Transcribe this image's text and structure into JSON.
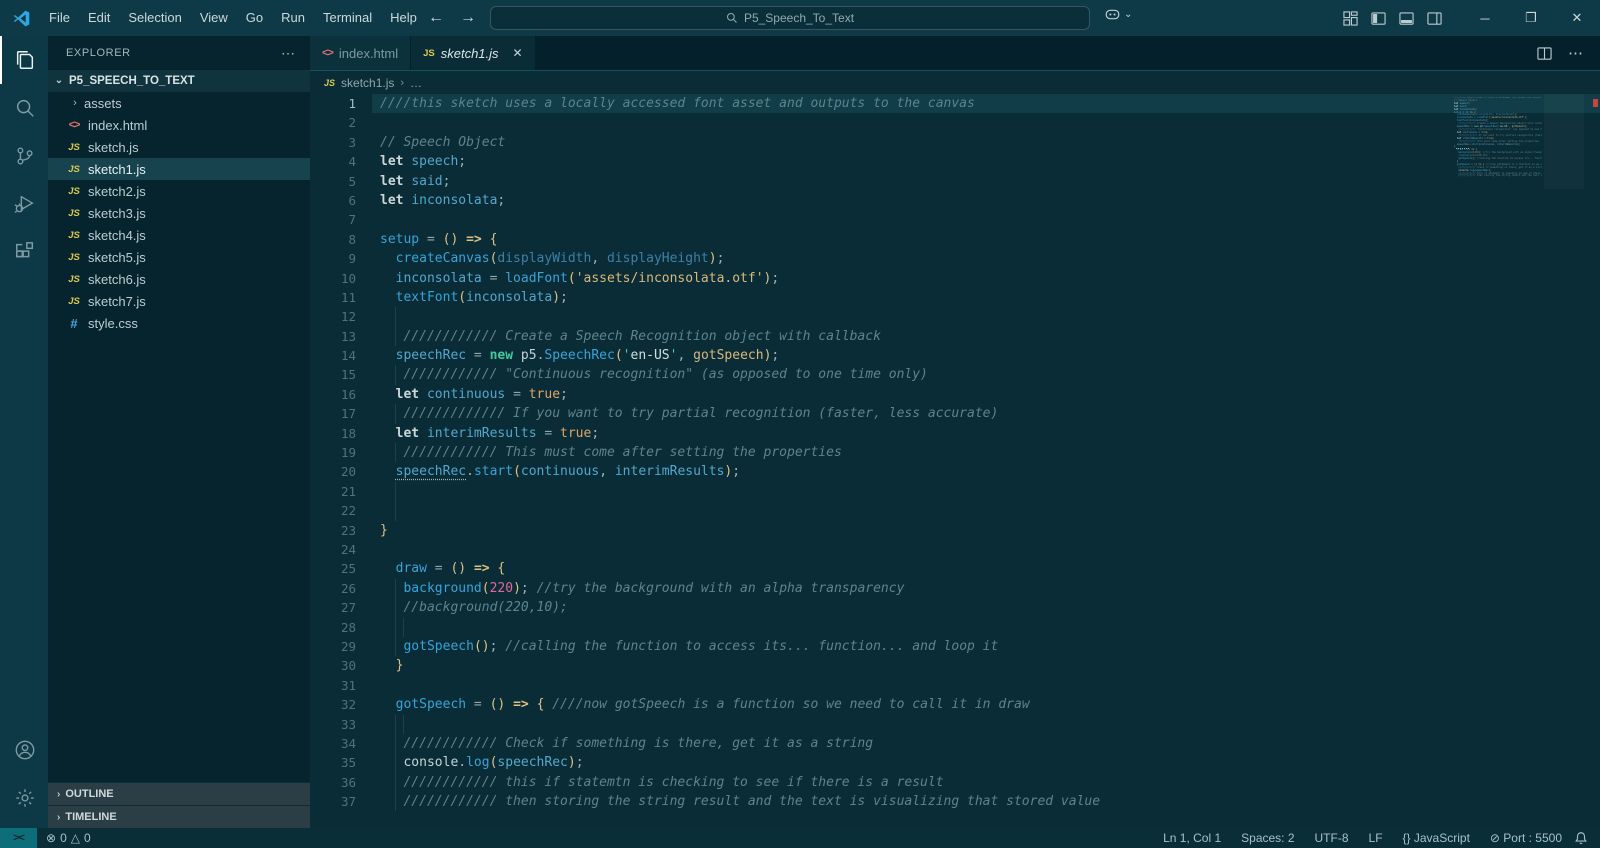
{
  "colors": {
    "accent_blue": "#2fa8e0",
    "titlebar_bg": "#0e3a47",
    "editor_bg": "#0a2c36",
    "sidebar_bg": "#05242d",
    "statusbar_bg": "#0a2e38",
    "remote_bg": "#0d6e79",
    "selection_row": "#17434e",
    "error_marker": "#c4483a"
  },
  "icons": {
    "back-arrow": "←",
    "forward-arrow": "→",
    "minimize": "─",
    "restore": "❐",
    "close": "✕",
    "ellipsis-h": "⋯",
    "more-dots": "…",
    "chevron-right": "›",
    "chevron-down": "⌄",
    "twisty-open": "⌄",
    "twisty-closed": "›",
    "js-file": "JS",
    "html-file": "<>",
    "css-file": "#",
    "error": "⊗",
    "warning": "△",
    "remote": "><"
  },
  "window": {
    "menus": [
      "File",
      "Edit",
      "Selection",
      "View",
      "Go",
      "Run",
      "Terminal",
      "Help"
    ],
    "search_text": "P5_Speech_To_Text",
    "controls": [
      {
        "name": "minimize-button",
        "glyph": "─"
      },
      {
        "name": "restore-button",
        "glyph": "❐"
      },
      {
        "name": "close-button",
        "glyph": "✕"
      }
    ]
  },
  "explorer": {
    "title": "EXPLORER",
    "actions": "⋯",
    "project": "P5_SPEECH_TO_TEXT",
    "items": [
      {
        "label": "assets",
        "icon": "folder",
        "kind": "folder"
      },
      {
        "label": "index.html",
        "icon": "html"
      },
      {
        "label": "sketch.js",
        "icon": "js"
      },
      {
        "label": "sketch1.js",
        "icon": "js",
        "selected": true
      },
      {
        "label": "sketch2.js",
        "icon": "js"
      },
      {
        "label": "sketch3.js",
        "icon": "js"
      },
      {
        "label": "sketch4.js",
        "icon": "js"
      },
      {
        "label": "sketch5.js",
        "icon": "js"
      },
      {
        "label": "sketch6.js",
        "icon": "js"
      },
      {
        "label": "sketch7.js",
        "icon": "js"
      },
      {
        "label": "style.css",
        "icon": "css"
      }
    ],
    "sections": [
      "OUTLINE",
      "TIMELINE"
    ]
  },
  "tabs": [
    {
      "label": "index.html",
      "icon": "html",
      "active": false
    },
    {
      "label": "sketch1.js",
      "icon": "js",
      "active": true,
      "close": "✕"
    }
  ],
  "breadcrumb": {
    "file": "sketch1.js",
    "sep": "›",
    "more": "…"
  },
  "editor": {
    "lines": [
      {
        "n": 1,
        "cur": true,
        "t": [
          [
            "cmt",
            "////this sketch uses a locally accessed font asset and outputs to the canvas"
          ]
        ]
      },
      {
        "n": 2,
        "t": []
      },
      {
        "n": 3,
        "t": [
          [
            "cmt",
            "// Speech Object"
          ]
        ]
      },
      {
        "n": 4,
        "t": [
          [
            "kw",
            "let"
          ],
          [
            "plain",
            " "
          ],
          [
            "var",
            "speech"
          ],
          [
            "punc",
            ";"
          ]
        ]
      },
      {
        "n": 5,
        "t": [
          [
            "kw",
            "let"
          ],
          [
            "plain",
            " "
          ],
          [
            "var",
            "said"
          ],
          [
            "punc",
            ";"
          ]
        ]
      },
      {
        "n": 6,
        "t": [
          [
            "kw",
            "let"
          ],
          [
            "plain",
            " "
          ],
          [
            "var",
            "inconsolata"
          ],
          [
            "punc",
            ";"
          ]
        ]
      },
      {
        "n": 7,
        "t": []
      },
      {
        "n": 8,
        "t": [
          [
            "fn",
            "setup"
          ],
          [
            "op",
            " = "
          ],
          [
            "brk",
            "() "
          ],
          [
            "arr",
            "=> "
          ],
          [
            "brk",
            "{"
          ]
        ]
      },
      {
        "n": 9,
        "t": [
          [
            "plain",
            "  "
          ],
          [
            "fn",
            "createCanvas"
          ],
          [
            "brk",
            "("
          ],
          [
            "param",
            "displayWidth"
          ],
          [
            "punc",
            ", "
          ],
          [
            "param",
            "displayHeight"
          ],
          [
            "brk",
            ")"
          ],
          [
            "punc",
            ";"
          ]
        ]
      },
      {
        "n": 10,
        "t": [
          [
            "plain",
            "  "
          ],
          [
            "var",
            "inconsolata"
          ],
          [
            "op",
            " = "
          ],
          [
            "fn",
            "loadFont"
          ],
          [
            "brk",
            "("
          ],
          [
            "str",
            "'assets/inconsolata.otf'"
          ],
          [
            "brk",
            ")"
          ],
          [
            "punc",
            ";"
          ]
        ]
      },
      {
        "n": 11,
        "t": [
          [
            "plain",
            "  "
          ],
          [
            "fn",
            "textFont"
          ],
          [
            "brk",
            "("
          ],
          [
            "var",
            "inconsolata"
          ],
          [
            "brk",
            ")"
          ],
          [
            "punc",
            ";"
          ]
        ]
      },
      {
        "n": 12,
        "g": 1,
        "t": []
      },
      {
        "n": 13,
        "g": 1,
        "t": [
          [
            "plain",
            "   "
          ],
          [
            "cmt",
            "//////////// Create a Speech Recognition object with callback"
          ]
        ]
      },
      {
        "n": 14,
        "t": [
          [
            "plain",
            "  "
          ],
          [
            "var",
            "speechRec"
          ],
          [
            "op",
            " = "
          ],
          [
            "kwg",
            "new"
          ],
          [
            "plain",
            " p5"
          ],
          [
            "punc",
            "."
          ],
          [
            "fn",
            "SpeechRec"
          ],
          [
            "brk",
            "("
          ],
          [
            "q",
            "'"
          ],
          [
            "sin",
            "en-US"
          ],
          [
            "q",
            "'"
          ],
          [
            "punc",
            ", "
          ],
          [
            "str",
            "gotSpeech"
          ],
          [
            "brk",
            ")"
          ],
          [
            "punc",
            ";"
          ]
        ]
      },
      {
        "n": 15,
        "g": 1,
        "t": [
          [
            "plain",
            "   "
          ],
          [
            "cmt",
            "//////////// \"Continuous recognition\" (as opposed to one time only)"
          ]
        ]
      },
      {
        "n": 16,
        "t": [
          [
            "plain",
            "  "
          ],
          [
            "kw",
            "let"
          ],
          [
            "plain",
            " "
          ],
          [
            "var",
            "continuous"
          ],
          [
            "op",
            " = "
          ],
          [
            "bool",
            "true"
          ],
          [
            "punc",
            ";"
          ]
        ]
      },
      {
        "n": 17,
        "g": 1,
        "t": [
          [
            "plain",
            "   "
          ],
          [
            "cmt",
            "///////////// If you want to try partial recognition (faster, less accurate)"
          ]
        ]
      },
      {
        "n": 18,
        "t": [
          [
            "plain",
            "  "
          ],
          [
            "kw",
            "let"
          ],
          [
            "plain",
            " "
          ],
          [
            "var",
            "interimResults"
          ],
          [
            "op",
            " = "
          ],
          [
            "bool",
            "true"
          ],
          [
            "punc",
            ";"
          ]
        ]
      },
      {
        "n": 19,
        "g": 1,
        "t": [
          [
            "plain",
            "   "
          ],
          [
            "cmt",
            "//////////// This must come after setting the properties"
          ]
        ]
      },
      {
        "n": 20,
        "t": [
          [
            "plain",
            "  "
          ],
          [
            "varh",
            "speechRec"
          ],
          [
            "punc",
            "."
          ],
          [
            "fn",
            "start"
          ],
          [
            "brk",
            "("
          ],
          [
            "var",
            "continuous"
          ],
          [
            "punc",
            ", "
          ],
          [
            "var",
            "interimResults"
          ],
          [
            "brk",
            ")"
          ],
          [
            "punc",
            ";"
          ]
        ]
      },
      {
        "n": 21,
        "g": 1,
        "t": []
      },
      {
        "n": 22,
        "g": 1,
        "t": []
      },
      {
        "n": 23,
        "t": [
          [
            "brk",
            "}"
          ]
        ]
      },
      {
        "n": 24,
        "t": []
      },
      {
        "n": 25,
        "t": [
          [
            "plain",
            "  "
          ],
          [
            "fn",
            "draw"
          ],
          [
            "op",
            " = "
          ],
          [
            "brk",
            "() "
          ],
          [
            "arr",
            "=> "
          ],
          [
            "brk",
            "{"
          ]
        ]
      },
      {
        "n": 26,
        "g": 1,
        "t": [
          [
            "plain",
            "   "
          ],
          [
            "fn",
            "background"
          ],
          [
            "brk",
            "("
          ],
          [
            "num",
            "220"
          ],
          [
            "brk",
            ")"
          ],
          [
            "punc",
            "; "
          ],
          [
            "cmt",
            "//try the background with an alpha transparency"
          ]
        ]
      },
      {
        "n": 27,
        "g": 1,
        "t": [
          [
            "plain",
            "   "
          ],
          [
            "cmt",
            "//background(220,10);"
          ]
        ]
      },
      {
        "n": 28,
        "g": 2,
        "t": []
      },
      {
        "n": 29,
        "g": 1,
        "t": [
          [
            "plain",
            "   "
          ],
          [
            "fn",
            "gotSpeech"
          ],
          [
            "brk",
            "()"
          ],
          [
            "punc",
            "; "
          ],
          [
            "cmt",
            "//calling the function to access its... function... and loop it"
          ]
        ]
      },
      {
        "n": 30,
        "t": [
          [
            "plain",
            "  "
          ],
          [
            "brk",
            "}"
          ]
        ]
      },
      {
        "n": 31,
        "t": []
      },
      {
        "n": 32,
        "t": [
          [
            "plain",
            "  "
          ],
          [
            "fn",
            "gotSpeech"
          ],
          [
            "op",
            " = "
          ],
          [
            "brk",
            "() "
          ],
          [
            "arr",
            "=> "
          ],
          [
            "brk",
            "{ "
          ],
          [
            "cmt",
            "////now gotSpeech is a function so we need to call it in draw"
          ]
        ]
      },
      {
        "n": 33,
        "g": 2,
        "t": []
      },
      {
        "n": 34,
        "g": 1,
        "t": [
          [
            "plain",
            "   "
          ],
          [
            "cmt",
            "//////////// Check if something is there, get it as a string"
          ]
        ]
      },
      {
        "n": 35,
        "g": 1,
        "t": [
          [
            "plain",
            "   "
          ],
          [
            "plain",
            "console"
          ],
          [
            "punc",
            "."
          ],
          [
            "fn",
            "log"
          ],
          [
            "brk",
            "("
          ],
          [
            "var",
            "speechRec"
          ],
          [
            "brk",
            ")"
          ],
          [
            "punc",
            ";"
          ]
        ]
      },
      {
        "n": 36,
        "g": 1,
        "t": [
          [
            "plain",
            "   "
          ],
          [
            "cmt",
            "//////////// this if statemtn is checking to see if there is a result"
          ]
        ]
      },
      {
        "n": 37,
        "g": 1,
        "t": [
          [
            "plain",
            "   "
          ],
          [
            "cmt",
            "//////////// then storing the string result and the text is visualizing that stored value"
          ]
        ]
      }
    ]
  },
  "status_bar": {
    "remote_glyph": "><",
    "problems": [
      {
        "name": "errors",
        "glyph": "⊗",
        "count": "0"
      },
      {
        "name": "warnings",
        "glyph": "△",
        "count": "0"
      }
    ],
    "right_items": [
      {
        "name": "cursor-position",
        "text": "Ln 1, Col 1"
      },
      {
        "name": "indentation",
        "text": "Spaces: 2"
      },
      {
        "name": "encoding",
        "text": "UTF-8"
      },
      {
        "name": "eol-sequence",
        "text": "LF"
      },
      {
        "name": "language-mode",
        "text": "{} JavaScript"
      },
      {
        "name": "live-server-port",
        "text": "⊘ Port : 5500"
      }
    ]
  }
}
